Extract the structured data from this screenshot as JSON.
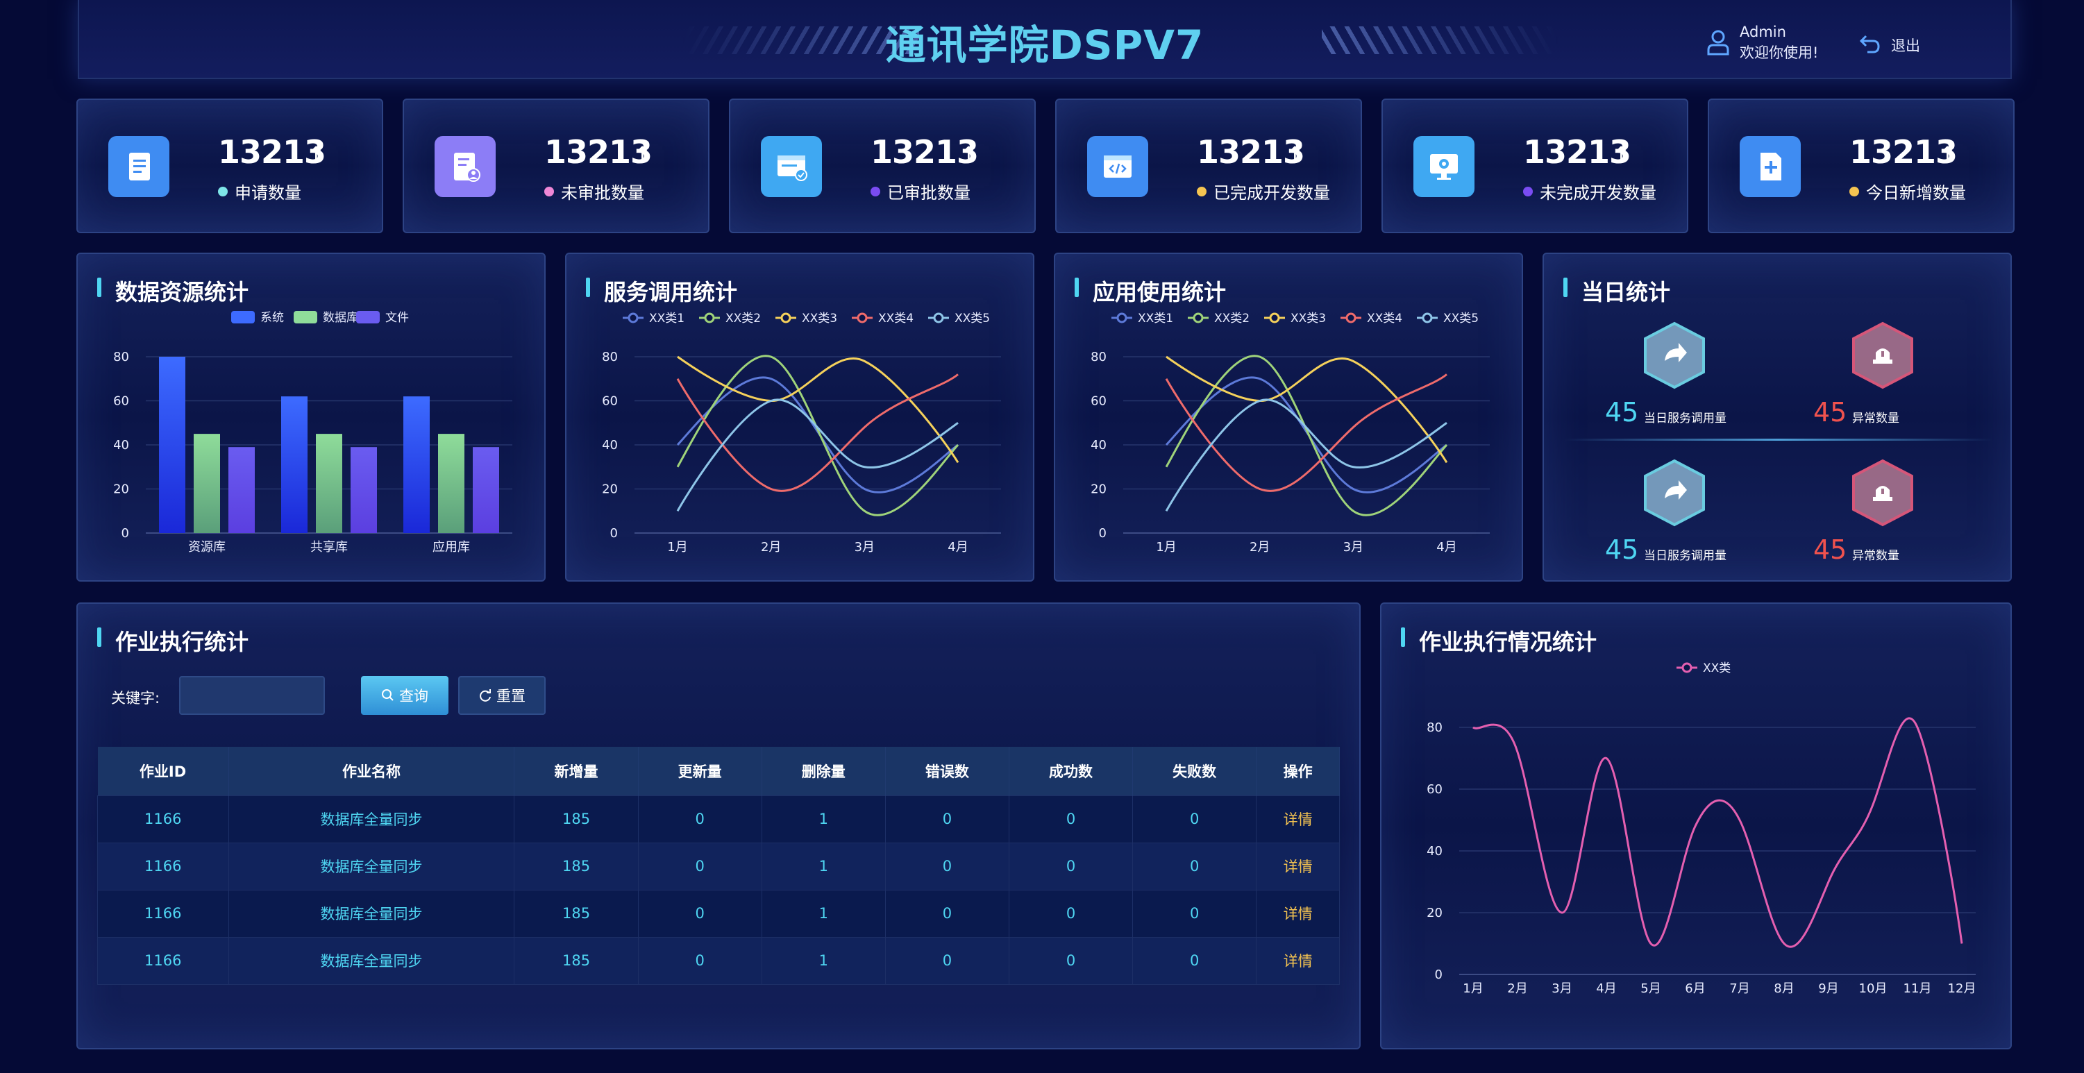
{
  "header": {
    "title": "通讯学院DSPV7",
    "user_name": "Admin",
    "welcome": "欢迎你使用!",
    "logout": "退出"
  },
  "stats": [
    {
      "value": "13213",
      "arrow": "↑",
      "label": "申请数量",
      "dot_color": "#7ee5e8",
      "icon": "document-icon",
      "icon_color": "#3f8cf2"
    },
    {
      "value": "13213",
      "arrow": "↑",
      "label": "未审批数量",
      "dot_color": "#ef87d6",
      "icon": "user-document-icon",
      "icon_color": "#8c7df6"
    },
    {
      "value": "13213",
      "arrow": "↑",
      "label": "已审批数量",
      "dot_color": "#7a4cf2",
      "icon": "approved-form-icon",
      "icon_color": "#3fa8f2"
    },
    {
      "value": "13213",
      "arrow": "↑",
      "label": "已完成开发数量",
      "dot_color": "#f5c451",
      "icon": "code-window-icon",
      "icon_color": "#3f8cf2"
    },
    {
      "value": "13213",
      "arrow": "↑",
      "label": "未完成开发数量",
      "dot_color": "#7a4cf2",
      "icon": "monitor-settings-icon",
      "icon_color": "#3fa8f2"
    },
    {
      "value": "13213",
      "arrow": "↑",
      "label": "今日新增数量",
      "dot_color": "#f5c451",
      "icon": "add-file-icon",
      "icon_color": "#3f8cf2"
    }
  ],
  "sections": {
    "data_resource": "数据资源统计",
    "service_call": "服务调用统计",
    "app_usage": "应用使用统计",
    "daily": "当日统计",
    "job_exec": "作业执行统计",
    "job_exec_status": "作业执行情况统计"
  },
  "daily_stats": [
    {
      "value": "45",
      "label": "当日服务调用量",
      "color": "#4fd6f2",
      "icon": "share-arrow-icon"
    },
    {
      "value": "45",
      "label": "异常数量",
      "color": "#f0524e",
      "icon": "alarm-icon"
    },
    {
      "value": "45",
      "label": "当日服务调用量",
      "color": "#4fd6f2",
      "icon": "share-arrow-icon"
    },
    {
      "value": "45",
      "label": "异常数量",
      "color": "#f0524e",
      "icon": "alarm-icon"
    }
  ],
  "search": {
    "keyword_label": "关键字:",
    "keyword_value": "",
    "query_button": "查询",
    "reset_button": "重置"
  },
  "table": {
    "headers": [
      "作业ID",
      "作业名称",
      "新增量",
      "更新量",
      "删除量",
      "错误数",
      "成功数",
      "失败数",
      "操作"
    ],
    "rows": [
      [
        "1166",
        "数据库全量同步",
        "185",
        "0",
        "1",
        "0",
        "0",
        "0",
        "详情"
      ],
      [
        "1166",
        "数据库全量同步",
        "185",
        "0",
        "1",
        "0",
        "0",
        "0",
        "详情"
      ],
      [
        "1166",
        "数据库全量同步",
        "185",
        "0",
        "1",
        "0",
        "0",
        "0",
        "详情"
      ],
      [
        "1166",
        "数据库全量同步",
        "185",
        "0",
        "1",
        "0",
        "0",
        "0",
        "详情"
      ]
    ]
  },
  "chart_data": [
    {
      "type": "bar",
      "categories": [
        "资源库",
        "共享库",
        "应用库"
      ],
      "series": [
        {
          "name": "系统",
          "values": [
            80,
            62,
            62
          ],
          "color": "#3d6bff"
        },
        {
          "name": "数据库",
          "values": [
            45,
            45,
            45
          ],
          "color": "#8fdc9a"
        },
        {
          "name": "文件",
          "values": [
            39,
            39,
            39
          ],
          "color": "#6a5cf0"
        }
      ],
      "ylim": [
        0,
        80
      ],
      "yticks": [
        0,
        20,
        40,
        60,
        80
      ],
      "legend": "top-center"
    },
    {
      "type": "line",
      "categories": [
        "1月",
        "2月",
        "3月",
        "4月"
      ],
      "series": [
        {
          "name": "XX类1",
          "values": [
            40,
            70,
            20,
            40
          ],
          "color": "#5d7ad9"
        },
        {
          "name": "XX类2",
          "values": [
            30,
            80,
            10,
            40
          ],
          "color": "#9fd37a"
        },
        {
          "name": "XX类3",
          "values": [
            80,
            60,
            78,
            32
          ],
          "color": "#f5d15b"
        },
        {
          "name": "XX类4",
          "values": [
            70,
            20,
            48,
            72
          ],
          "color": "#ef6b6b"
        },
        {
          "name": "XX类5",
          "values": [
            10,
            60,
            30,
            50
          ],
          "color": "#8ec5e8"
        }
      ],
      "ylim": [
        0,
        80
      ],
      "yticks": [
        0,
        20,
        40,
        60,
        80
      ],
      "legend": "top-center"
    },
    {
      "type": "line",
      "categories": [
        "1月",
        "2月",
        "3月",
        "4月"
      ],
      "series": [
        {
          "name": "XX类1",
          "values": [
            40,
            70,
            20,
            40
          ],
          "color": "#5d7ad9"
        },
        {
          "name": "XX类2",
          "values": [
            30,
            80,
            10,
            40
          ],
          "color": "#9fd37a"
        },
        {
          "name": "XX类3",
          "values": [
            80,
            60,
            78,
            32
          ],
          "color": "#f5d15b"
        },
        {
          "name": "XX类4",
          "values": [
            70,
            20,
            48,
            72
          ],
          "color": "#ef6b6b"
        },
        {
          "name": "XX类5",
          "values": [
            10,
            60,
            30,
            50
          ],
          "color": "#8ec5e8"
        }
      ],
      "ylim": [
        0,
        80
      ],
      "yticks": [
        0,
        20,
        40,
        60,
        80
      ],
      "legend": "top-center"
    },
    {
      "type": "line",
      "categories": [
        "1月",
        "2月",
        "3月",
        "4月",
        "5月",
        "6月",
        "7月",
        "8月",
        "9月",
        "10月",
        "11月",
        "12月"
      ],
      "series": [
        {
          "name": "XX类",
          "values": [
            80,
            72,
            20,
            70,
            10,
            48,
            50,
            10,
            30,
            55,
            80,
            10
          ],
          "color": "#e45fb0"
        }
      ],
      "ylim": [
        0,
        80
      ],
      "yticks": [
        0,
        20,
        40,
        60,
        80
      ],
      "legend": "top-center"
    }
  ]
}
